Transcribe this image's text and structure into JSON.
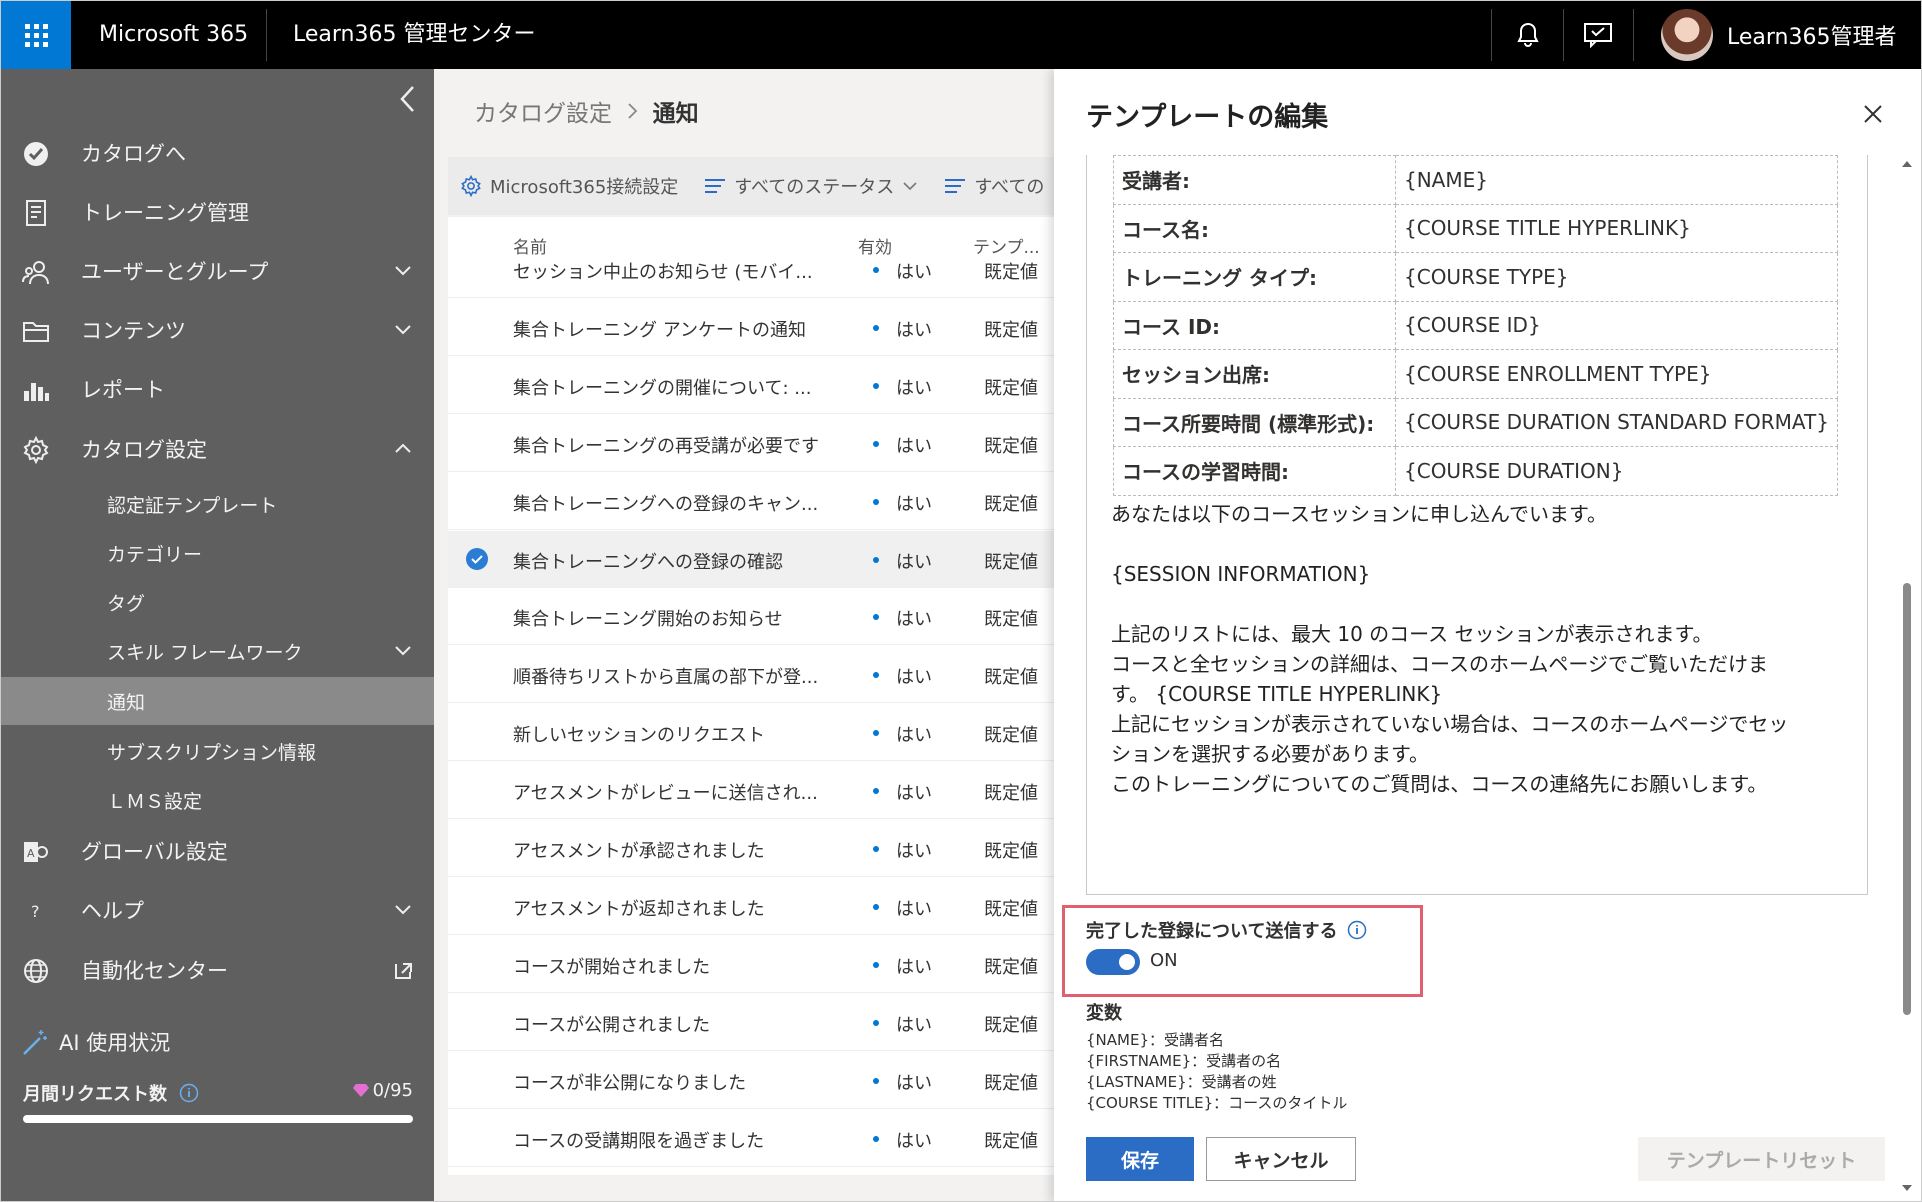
{
  "header": {
    "suite": "Microsoft 365",
    "app": "Learn365 管理センター",
    "user": "Learn365管理者"
  },
  "sidebar": {
    "items": [
      {
        "label": "カタログへ",
        "icon": "catalog-check-icon"
      },
      {
        "label": "トレーニング管理",
        "icon": "training-doc-icon"
      },
      {
        "label": "ユーザーとグループ",
        "icon": "users-icon"
      },
      {
        "label": "コンテンツ",
        "icon": "folder-icon"
      },
      {
        "label": "レポート",
        "icon": "bar-chart-icon"
      },
      {
        "label": "カタログ設定",
        "icon": "gear-icon"
      },
      {
        "label": "グローバル設定",
        "icon": "global-settings-icon"
      },
      {
        "label": "ヘルプ",
        "icon": "help-icon"
      },
      {
        "label": "自動化センター",
        "icon": "globe-icon"
      }
    ],
    "subitems": [
      "認定証テンプレート",
      "カテゴリー",
      "タグ",
      "スキル フレームワーク",
      "通知",
      "サブスクリプション情報",
      "ＬＭＳ設定"
    ],
    "ai_usage": "AI 使用状況",
    "monthly_requests": "月間リクエスト数",
    "request_count": "0/95",
    "request_fraction": 0.0
  },
  "main": {
    "breadcrumb": {
      "parent": "カタログ設定",
      "current": "通知"
    },
    "toolbar": {
      "connect": "Microsoft365接続設定",
      "status": "すべてのステータス",
      "other": "すべての"
    },
    "columns": {
      "name": "名前",
      "enabled": "有効",
      "template": "テンプ..."
    },
    "rows": [
      {
        "name": "セッション中止のお知らせ (モバイ...",
        "enabled": "はい",
        "template": "既定値"
      },
      {
        "name": "集合トレーニング アンケートの通知",
        "enabled": "はい",
        "template": "既定値"
      },
      {
        "name": "集合トレーニングの開催について: ...",
        "enabled": "はい",
        "template": "既定値"
      },
      {
        "name": "集合トレーニングの再受講が必要です",
        "enabled": "はい",
        "template": "既定値"
      },
      {
        "name": "集合トレーニングへの登録のキャン...",
        "enabled": "はい",
        "template": "既定値"
      },
      {
        "name": "集合トレーニングへの登録の確認",
        "enabled": "はい",
        "template": "既定値"
      },
      {
        "name": "集合トレーニング開始のお知らせ",
        "enabled": "はい",
        "template": "既定値"
      },
      {
        "name": "順番待ちリストから直属の部下が登...",
        "enabled": "はい",
        "template": "既定値"
      },
      {
        "name": "新しいセッションのリクエスト",
        "enabled": "はい",
        "template": "既定値"
      },
      {
        "name": "アセスメントがレビューに送信され...",
        "enabled": "はい",
        "template": "既定値"
      },
      {
        "name": "アセスメントが承認されました",
        "enabled": "はい",
        "template": "既定値"
      },
      {
        "name": "アセスメントが返却されました",
        "enabled": "はい",
        "template": "既定値"
      },
      {
        "name": "コースが開始されました",
        "enabled": "はい",
        "template": "既定値"
      },
      {
        "name": "コースが公開されました",
        "enabled": "はい",
        "template": "既定値"
      },
      {
        "name": "コースが非公開になりました",
        "enabled": "はい",
        "template": "既定値"
      },
      {
        "name": "コースの受講期限を過ぎました",
        "enabled": "はい",
        "template": "既定値"
      }
    ]
  },
  "panel": {
    "title": "テンプレートの編集",
    "table": [
      {
        "k": "受講者:",
        "v": "{NAME}"
      },
      {
        "k": "コース名:",
        "v": "{COURSE TITLE HYPERLINK}"
      },
      {
        "k": "トレーニング タイプ:",
        "v": "{COURSE TYPE}"
      },
      {
        "k": "コース ID:",
        "v": "{COURSE ID}"
      },
      {
        "k": "セッション出席:",
        "v": "{COURSE ENROLLMENT TYPE}"
      },
      {
        "k": "コース所要時間 (標準形式):",
        "v": "{COURSE DURATION STANDARD FORMAT}"
      },
      {
        "k": "コースの学習時間:",
        "v": "{COURSE DURATION}"
      }
    ],
    "body": {
      "l1": "あなたは以下のコースセッションに申し込んでいます。",
      "l2": "{SESSION INFORMATION}",
      "l3": "上記のリストには、最大 10 のコース セッションが表示されます。",
      "l4": "コースと全セッションの詳細は、コースのホームページでご覧いただけま",
      "l5": "す。 {COURSE TITLE HYPERLINK}",
      "l6": "上記にセッションが表示されていない場合は、コースのホームページでセッ",
      "l7": "ションを選択する必要があります。",
      "l8": "このトレーニングについてのご質問は、コースの連絡先にお願いします。"
    },
    "toggle_label": "完了した登録について送信する",
    "toggle_state": "ON",
    "variables_title": "変数",
    "variables": [
      "{NAME}：受講者名",
      "{FIRSTNAME}：受講者の名",
      "{LASTNAME}：受講者の姓",
      "{COURSE TITLE}：コースのタイトル"
    ],
    "save": "保存",
    "cancel": "キャンセル",
    "reset": "テンプレートリセット"
  }
}
